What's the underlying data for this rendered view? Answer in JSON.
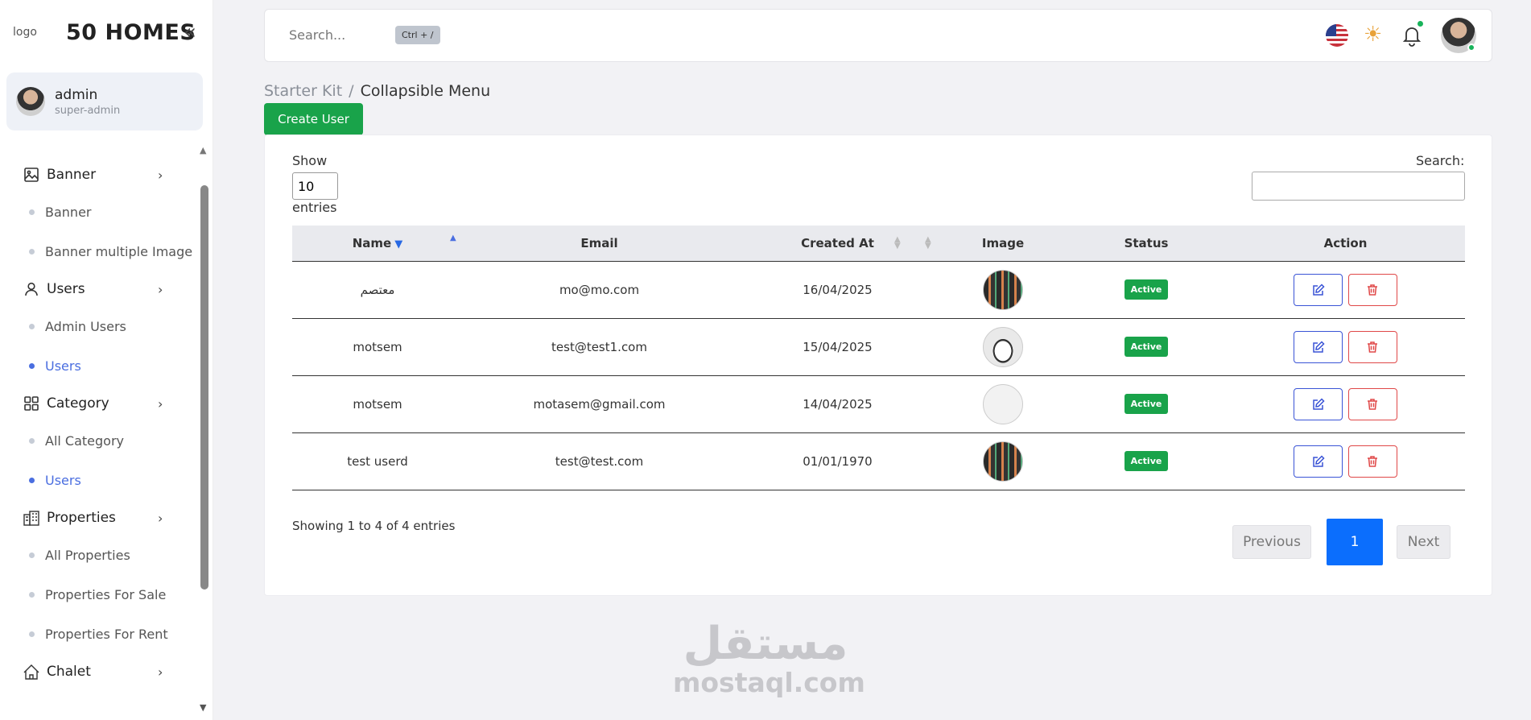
{
  "brand": {
    "logo_alt": "logo",
    "name": "50 HOMES"
  },
  "user": {
    "name": "admin",
    "role": "super-admin"
  },
  "sidebar": {
    "groups": [
      {
        "label": "Banner",
        "icon": "image-icon",
        "items": [
          {
            "label": "Banner",
            "active": false
          },
          {
            "label": "Banner multiple Image",
            "active": false
          }
        ]
      },
      {
        "label": "Users",
        "icon": "user-icon",
        "items": [
          {
            "label": "Admin Users",
            "active": false
          },
          {
            "label": "Users",
            "active": true
          }
        ]
      },
      {
        "label": "Category",
        "icon": "grid-icon",
        "items": [
          {
            "label": "All Category",
            "active": false
          },
          {
            "label": "Users",
            "active": true
          }
        ]
      },
      {
        "label": "Properties",
        "icon": "buildings-icon",
        "items": [
          {
            "label": "All Properties",
            "active": false
          },
          {
            "label": "Properties For Sale",
            "active": false
          },
          {
            "label": "Properties For Rent",
            "active": false
          }
        ]
      },
      {
        "label": "Chalet",
        "icon": "chalet-icon",
        "items": []
      }
    ]
  },
  "topbar": {
    "search_placeholder": "Search...",
    "shortcut": "Ctrl + /"
  },
  "breadcrumb": {
    "parent": "Starter Kit",
    "separator": "/",
    "current": "Collapsible Menu"
  },
  "create_button": "Create User",
  "table_controls": {
    "show": "Show",
    "page_size": "10",
    "entries": "entries",
    "search_label": "Search:"
  },
  "table": {
    "columns": [
      "Name",
      "Email",
      "Created At",
      "Image",
      "Status",
      "Action"
    ],
    "rows": [
      {
        "name": "معتصم",
        "email": "mo@mo.com",
        "created_at": "16/04/2025",
        "status": "Active"
      },
      {
        "name": "motsem",
        "email": "test@test1.com",
        "created_at": "15/04/2025",
        "status": "Active"
      },
      {
        "name": "motsem",
        "email": "motasem@gmail.com",
        "created_at": "14/04/2025",
        "status": "Active"
      },
      {
        "name": "test userd",
        "email": "test@test.com",
        "created_at": "01/01/1970",
        "status": "Active"
      }
    ]
  },
  "footer": {
    "showing": "Showing 1 to 4 of 4 entries",
    "previous": "Previous",
    "page": "1",
    "next": "Next"
  },
  "watermark": {
    "arabic": "مستقل",
    "english": "mostaql.com"
  },
  "colors": {
    "primary": "#0b6efd",
    "success": "#19a34a",
    "accent": "#4a6ee0",
    "danger": "#e04848"
  }
}
